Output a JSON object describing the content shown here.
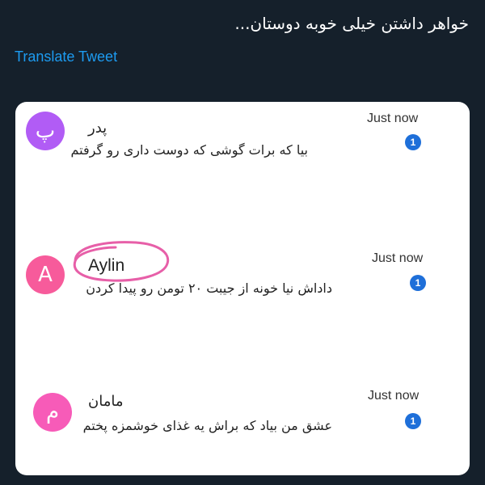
{
  "tweet": {
    "text": "خواهر داشتن خیلی خوبه دوستان...",
    "translate_label": "Translate Tweet"
  },
  "notifications": [
    {
      "avatar_letter": "پ",
      "avatar_color": "#b15cf5",
      "sender": "پدر",
      "message": "بیا که برات گوشی که دوست داری رو گرفتم",
      "time": "Just now",
      "badge": "1"
    },
    {
      "avatar_letter": "A",
      "avatar_color": "#f75b9b",
      "sender": "Aylin",
      "message": "داداش نیا خونه از جیبت ۲۰ تومن رو پیدا کردن",
      "time": "Just now",
      "badge": "1"
    },
    {
      "avatar_letter": "م",
      "avatar_color": "#f75bb8",
      "sender": "ماما​ن",
      "message": "عشق من بیاد که براش یه غذای خوشمزه پختم",
      "time": "Just now",
      "badge": "1"
    }
  ],
  "colors": {
    "background": "#15202b",
    "link": "#1d9bf0",
    "badge": "#1e6fd9",
    "highlight_circle": "#e75fa8"
  }
}
